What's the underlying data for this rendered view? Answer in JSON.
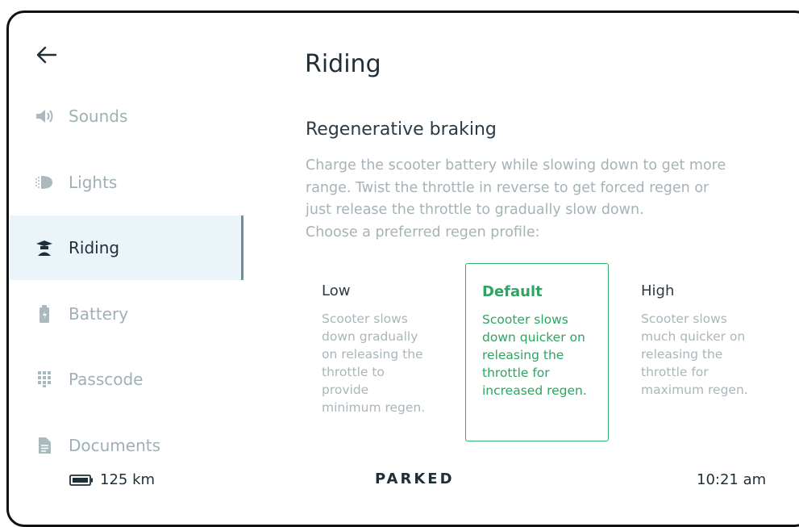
{
  "nav": {
    "items": [
      {
        "label": "Sounds",
        "icon": "speaker-icon"
      },
      {
        "label": "Lights",
        "icon": "headlight-icon"
      },
      {
        "label": "Riding",
        "icon": "scooter-icon"
      },
      {
        "label": "Battery",
        "icon": "battery-icon"
      },
      {
        "label": "Passcode",
        "icon": "keypad-icon"
      },
      {
        "label": "Documents",
        "icon": "document-icon"
      }
    ],
    "active": "Riding"
  },
  "page": {
    "title": "Riding",
    "section_title": "Regenerative braking",
    "description_lines": [
      "Charge the scooter battery while slowing down to get more",
      "range. Twist the throttle in reverse to get forced regen or",
      "just release the throttle to gradually slow down.",
      "Choose a preferred regen profile:"
    ]
  },
  "regen_options": [
    {
      "label": "Low",
      "lines": [
        "Scooter slows",
        "down gradually",
        "on releasing the",
        "throttle to",
        "provide",
        "minimum regen."
      ]
    },
    {
      "label": "Default",
      "lines": [
        "Scooter slows",
        "down quicker on",
        "releasing the",
        "throttle for",
        "increased regen."
      ]
    },
    {
      "label": "High",
      "lines": [
        "Scooter slows",
        "much quicker on",
        "releasing the",
        "throttle for",
        "maximum regen."
      ]
    }
  ],
  "selected_option": "Default",
  "status_bar": {
    "range": "125 km",
    "state": "PARKED",
    "time": "10:21 am"
  },
  "colors": {
    "accent": "#2ea462",
    "active_bg": "#eaf4f9",
    "muted_text": "#9fb0b5"
  }
}
